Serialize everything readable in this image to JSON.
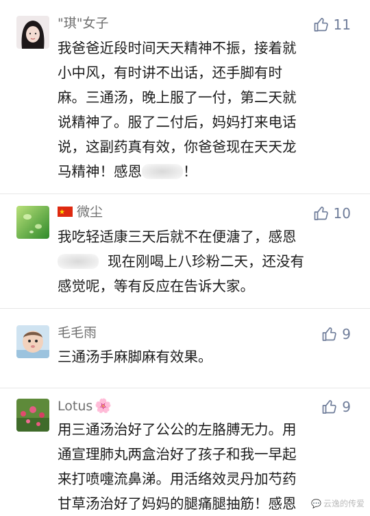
{
  "comments": [
    {
      "username": "\"琪\"女子",
      "likes": "11",
      "lines": [
        "我爸爸近段时间天天精神不振，接着就",
        "小中风，有时讲不出话，还手脚有时",
        "麻。三通汤，晚上服了一付，第二天就",
        "说精神了。服了二付后，妈妈打来电话",
        "说，这副药真有效，你爸爸现在天天龙"
      ],
      "last_before": "马精神！感恩",
      "last_after": "！"
    },
    {
      "username": "微尘",
      "likes": "10",
      "line1": "我吃轻适康三天后就不在便溏了，感恩",
      "line2_after": "现在刚喝上八珍粉二天，还没有",
      "line3": "感觉呢，等有反应在告诉大家。"
    },
    {
      "username": "毛毛雨",
      "likes": "9",
      "line1": "三通汤手麻脚麻有效果。"
    },
    {
      "username": "Lotus",
      "username_emoji": "🌸",
      "likes": "9",
      "lines": [
        "用三通汤治好了公公的左胳膊无力。用",
        "通宣理肺丸两盒治好了孩子和我一早起",
        "来打喷嚏流鼻涕。用活络效灵丹加芍药",
        "甘草汤治好了妈妈的腿痛腿抽筋！感恩"
      ]
    }
  ],
  "watermark": "云逸的传爱",
  "colors": {
    "like": "#6e7c99",
    "username": "#6f6f6f",
    "text": "#1c1c1c"
  }
}
